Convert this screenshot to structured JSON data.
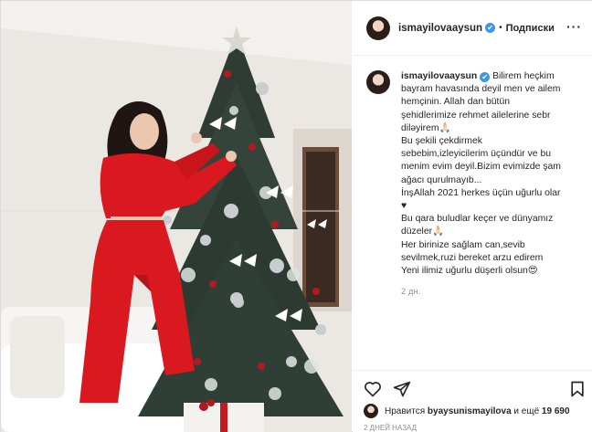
{
  "account": {
    "username": "ismayilovaaysun",
    "verified_mark": "✔",
    "separator": "•",
    "follow_label": "Подписки",
    "more_label": "···"
  },
  "caption": {
    "lines": [
      "Bilirem heçkim",
      "bayram havasında deyil men ve ailem",
      "hemçinin. Allah dan bütün",
      "şehidlerimize rehmet ailelerine sebr",
      "diləyirem🙏🏻",
      "Bu şekili çekdirmek",
      "sebebim,izleyicilerim üçündür ve bu",
      "menim evim deyil.Bizim evimizde şam",
      "ağacı qurulmayıb...",
      "İnşAllah 2021 herkes üçün uğurlu olar",
      "♥",
      "Bu qara buludlar keçer ve dünyamız",
      "düzeler🙏🏻",
      "Her birinize sağlam can,sevib",
      "sevilmek,ruzi bereket arzu edirem",
      "Yeni ilimiz uğurlu düşerli olsun😍"
    ],
    "time_ago": "2 дн."
  },
  "actions": {
    "like_icon": "heart-outline-icon",
    "share_icon": "paper-plane-icon",
    "save_icon": "bookmark-icon"
  },
  "likes": {
    "prefix": "Нравится",
    "user": "byaysunismayilova",
    "suffix": "и ещё",
    "count": "19 690"
  },
  "post_date": "2 ДНЕЙ НАЗАД",
  "colors": {
    "verified": "#3897f0",
    "outfit_red": "#d9181f",
    "tree_green": "#2f3c33",
    "wall": "#ece8e3"
  }
}
